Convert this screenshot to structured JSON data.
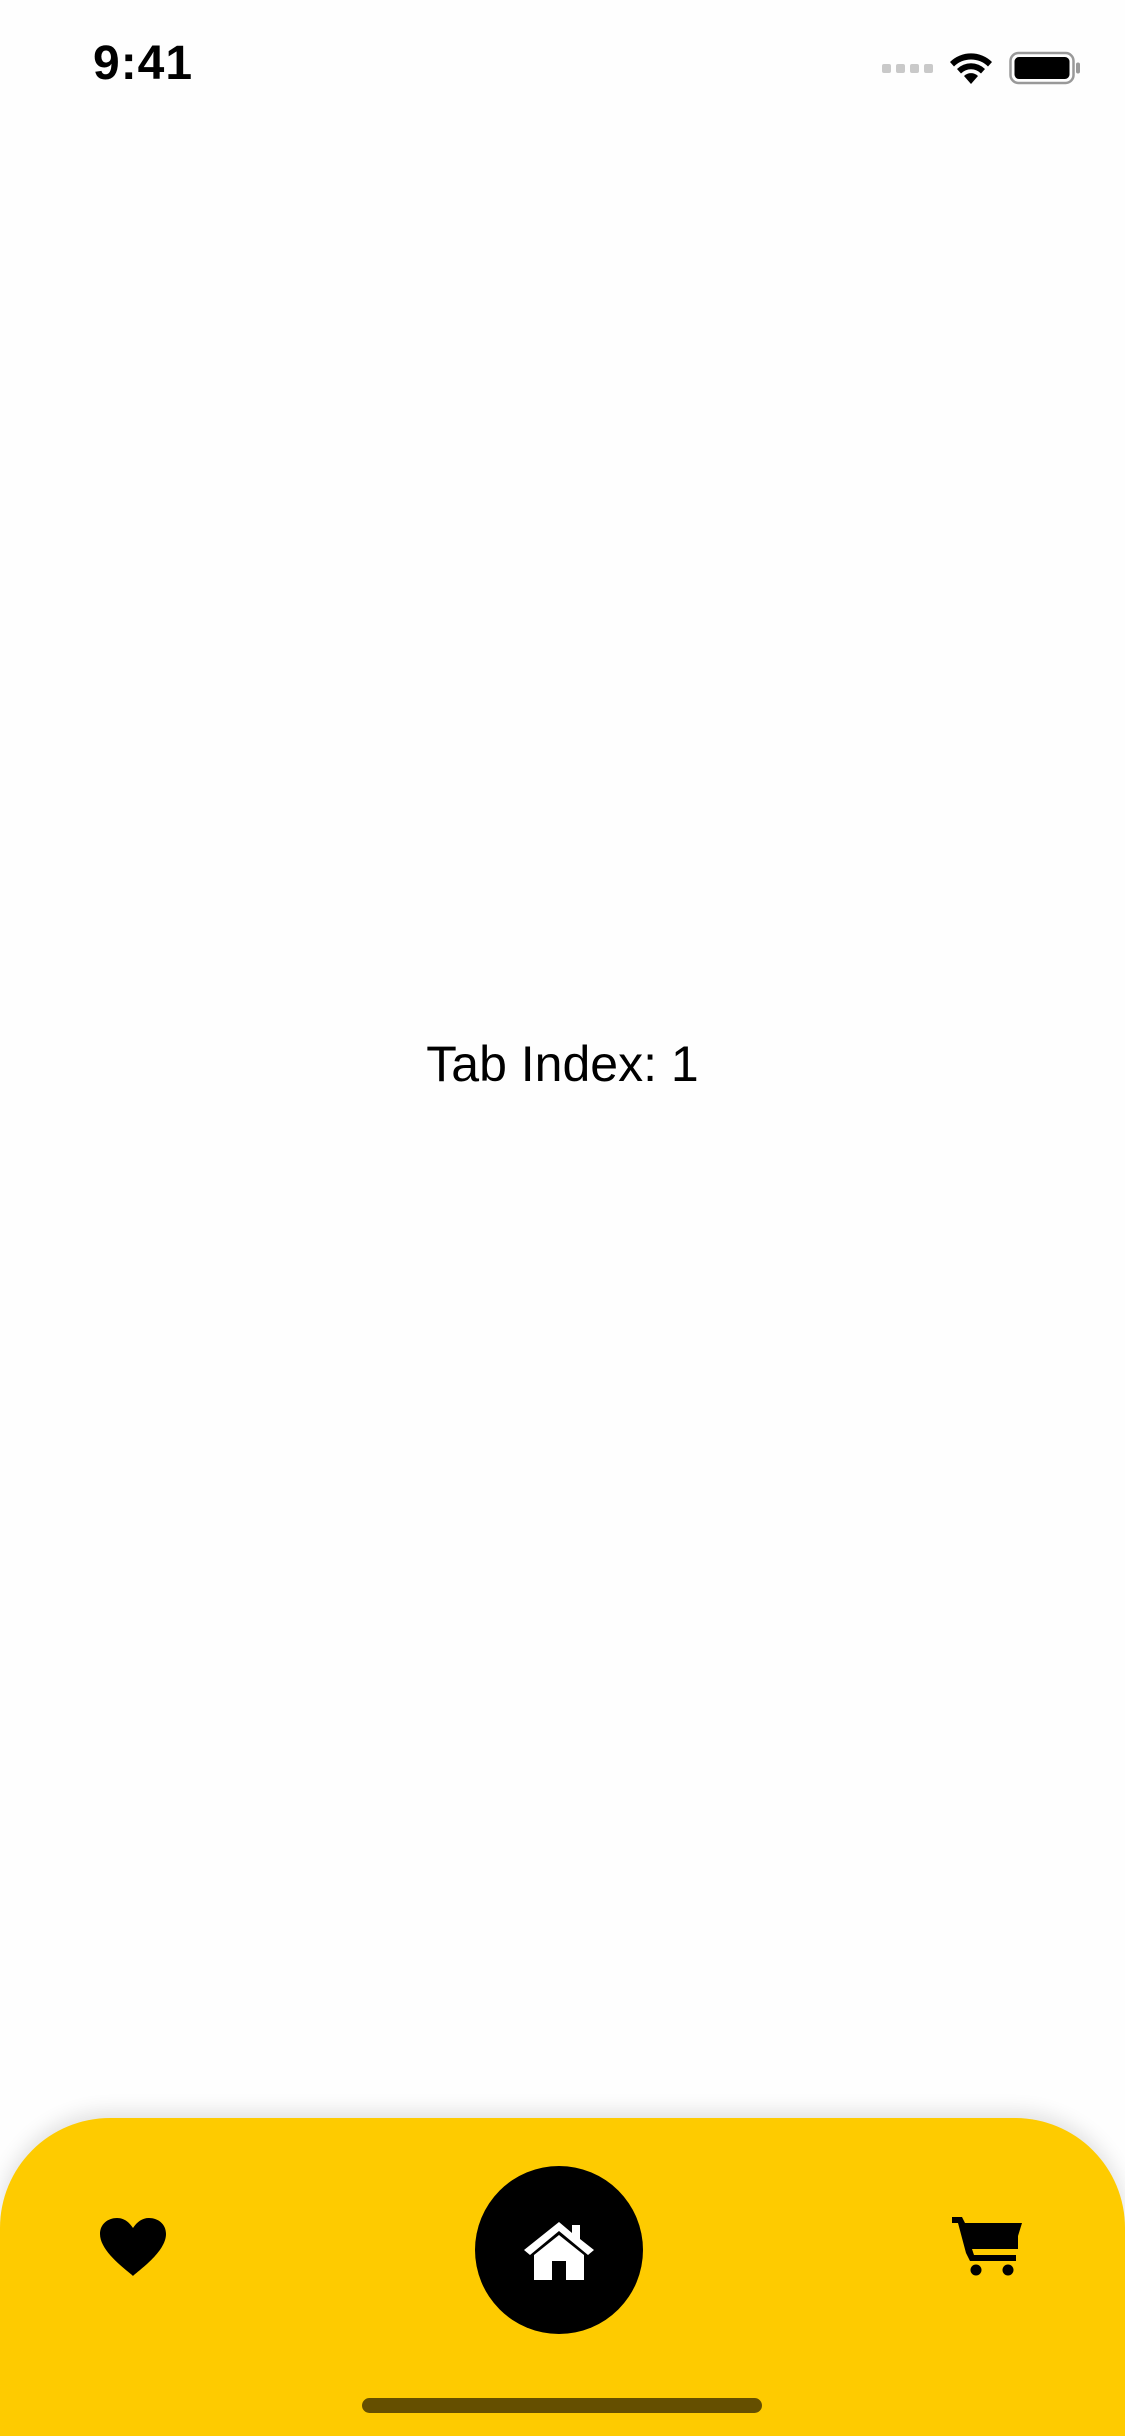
{
  "status_bar": {
    "time": "9:41"
  },
  "main": {
    "text": "Tab Index: 1"
  },
  "tab_bar": {
    "background_color": "#fecb00",
    "selected_index": 1,
    "tabs": [
      {
        "icon": "heart-icon"
      },
      {
        "icon": "home-icon"
      },
      {
        "icon": "cart-icon"
      }
    ]
  }
}
